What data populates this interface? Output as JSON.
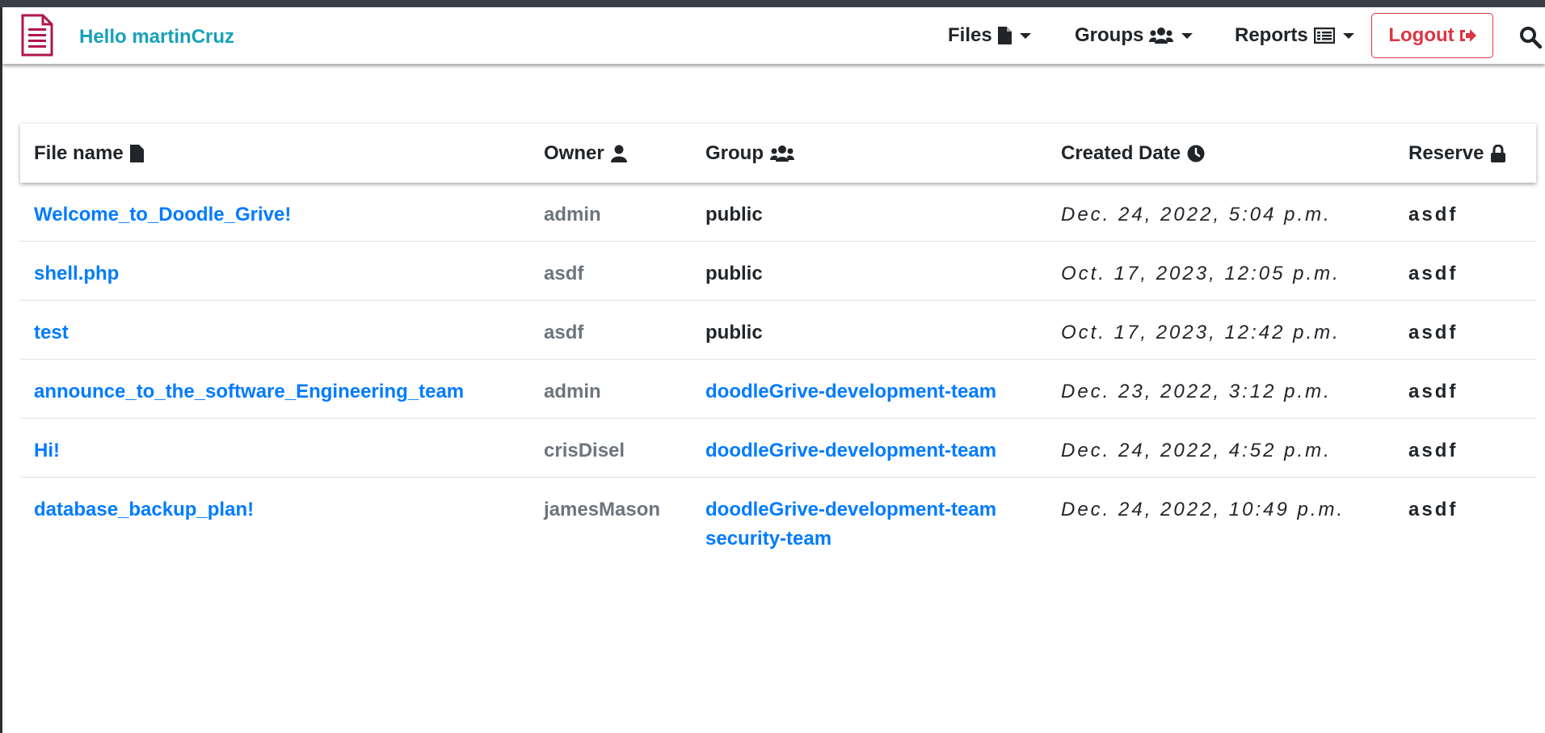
{
  "header": {
    "greeting": "Hello martinCruz",
    "nav": {
      "files": "Files",
      "groups": "Groups",
      "reports": "Reports"
    },
    "logout": "Logout"
  },
  "table": {
    "columns": {
      "file_name": "File name",
      "owner": "Owner",
      "group": "Group",
      "created_date": "Created Date",
      "reserve": "Reserve"
    },
    "rows": [
      {
        "file": "Welcome_to_Doodle_Grive!",
        "owner": "admin",
        "groups": [
          "public"
        ],
        "date": "Dec. 24, 2022, 5:04 p.m.",
        "reserve": "asdf"
      },
      {
        "file": "shell.php",
        "owner": "asdf",
        "groups": [
          "public"
        ],
        "date": "Oct. 17, 2023, 12:05 p.m.",
        "reserve": "asdf"
      },
      {
        "file": "test",
        "owner": "asdf",
        "groups": [
          "public"
        ],
        "date": "Oct. 17, 2023, 12:42 p.m.",
        "reserve": "asdf"
      },
      {
        "file": "announce_to_the_software_Engineering_team",
        "owner": "admin",
        "groups": [
          "doodleGrive-development-team"
        ],
        "date": "Dec. 23, 2022, 3:12 p.m.",
        "reserve": "asdf"
      },
      {
        "file": "Hi!",
        "owner": "crisDisel",
        "groups": [
          "doodleGrive-development-team"
        ],
        "date": "Dec. 24, 2022, 4:52 p.m.",
        "reserve": "asdf"
      },
      {
        "file": "database_backup_plan!",
        "owner": "jamesMason",
        "groups": [
          "doodleGrive-development-team",
          "security-team"
        ],
        "date": "Dec. 24, 2022, 10:49 p.m.",
        "reserve": "asdf"
      }
    ]
  },
  "colors": {
    "brand_logo": "#b0164f",
    "greeting": "#17a2b8",
    "link": "#007bff",
    "owner": "#6c757d",
    "danger": "#dc3545"
  },
  "icons": {
    "brand": "document-list-icon",
    "files": "file-icon",
    "groups": "users-icon",
    "reports": "table-list-icon",
    "logout": "sign-out-icon",
    "search": "search-icon",
    "owner": "user-icon",
    "created_date": "clock-icon",
    "reserve": "lock-icon"
  }
}
